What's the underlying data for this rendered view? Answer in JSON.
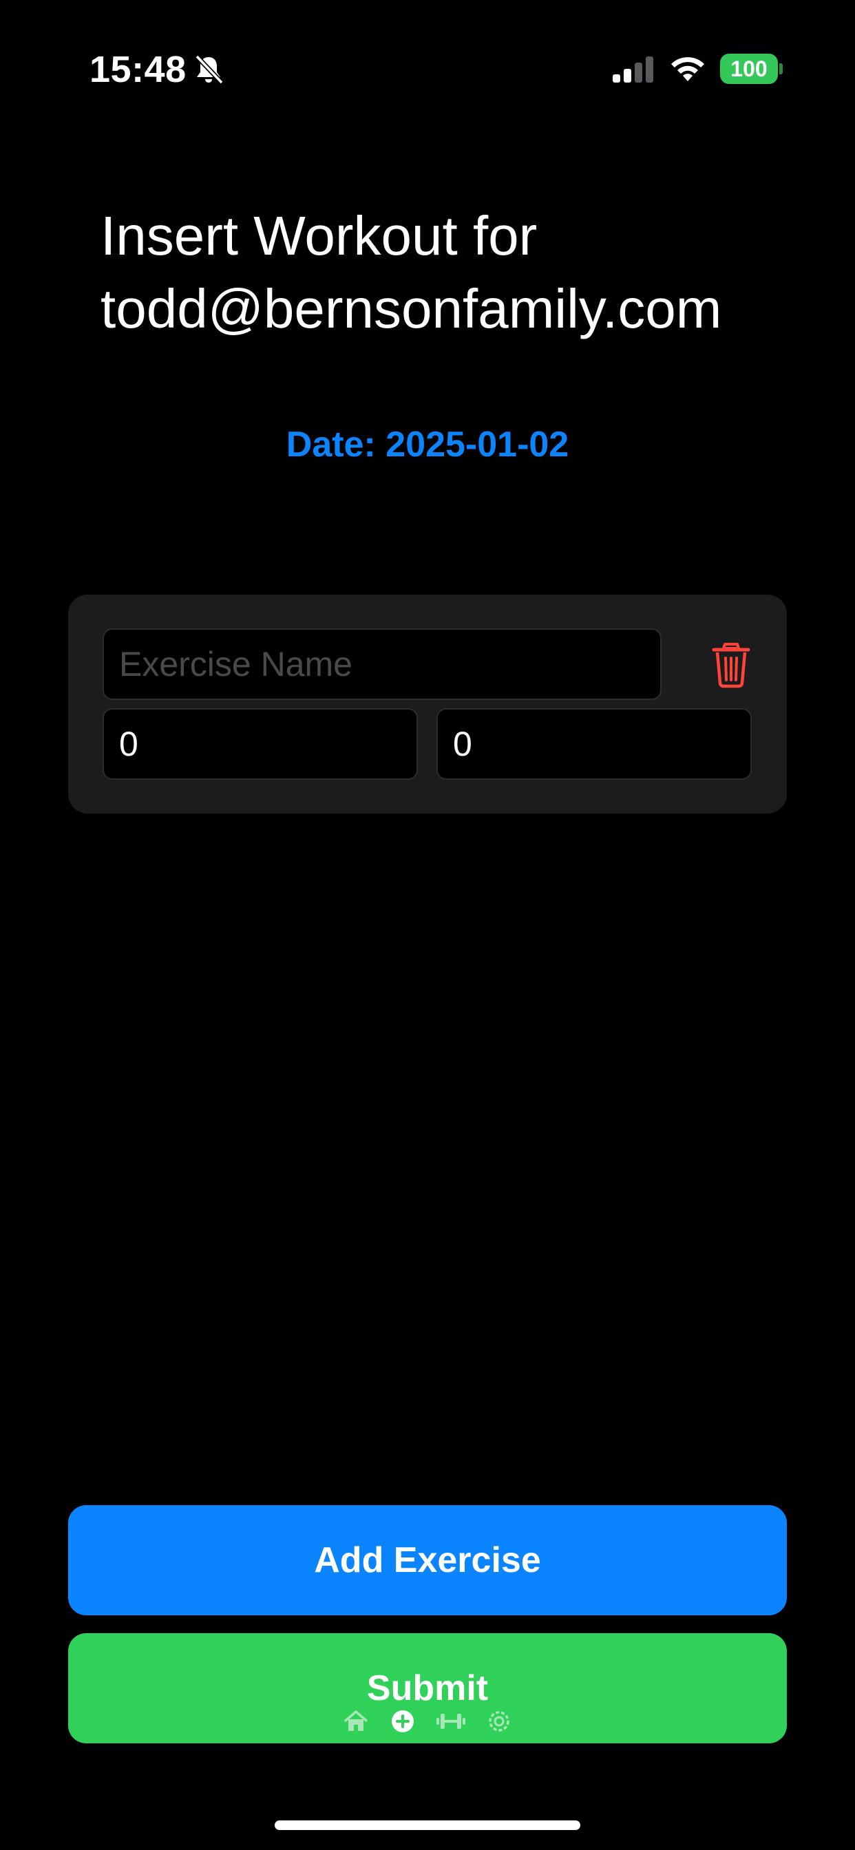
{
  "status_bar": {
    "time": "15:48",
    "battery": "100",
    "icons": [
      "bell-slash-icon",
      "signal-icon",
      "wifi-icon",
      "battery-icon"
    ]
  },
  "header": {
    "title": "Insert Workout for todd@bernsonfamily.com"
  },
  "date": {
    "label": "Date: 2025-01-02"
  },
  "exercise": {
    "name_placeholder": "Exercise Name",
    "name_value": "",
    "sets_value": "0",
    "reps_value": "0",
    "delete_icon": "trash-icon"
  },
  "actions": {
    "add_exercise_label": "Add Exercise",
    "submit_label": "Submit"
  },
  "tab_bar": {
    "icons": [
      "home-icon",
      "plus-circle-icon",
      "dumbbell-icon",
      "gear-icon"
    ]
  },
  "colors": {
    "background": "#000000",
    "card": "#1c1c1e",
    "accent_blue": "#0a84ff",
    "accent_green": "#30d158",
    "danger_red": "#ff453a",
    "battery_green": "#34c759"
  }
}
